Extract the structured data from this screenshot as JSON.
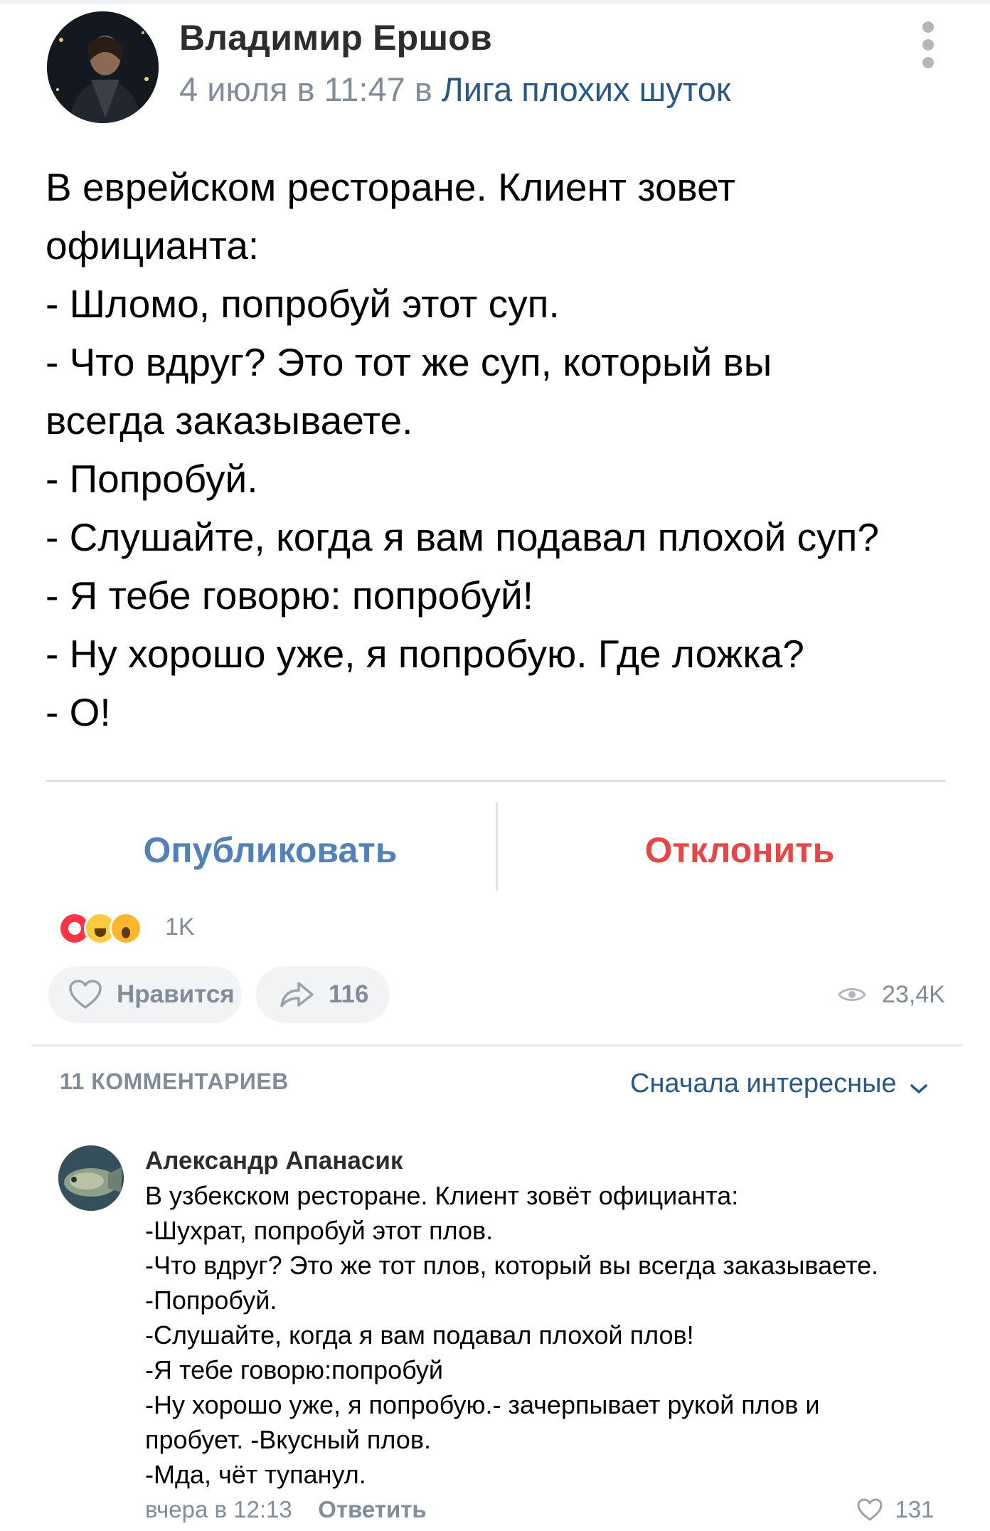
{
  "post": {
    "author": "Владимир Ершов",
    "date": "4 июля в 11:47 в",
    "group": "Лига плохих шуток",
    "text_lines": [
      "В еврейском ресторане. Клиент зовет",
      "официанта:",
      "- Шломо, попробуй этот суп.",
      "- Что вдруг? Это тот же суп, который вы",
      "всегда заказываете.",
      "- Попробуй.",
      "- Слушайте, когда я вам подавал плохой суп?",
      "- Я тебе говорю: попробуй!",
      "- Ну хорошо уже, я попробую. Где ложка?",
      "- О!"
    ]
  },
  "actions": {
    "publish": "Опубликовать",
    "reject": "Отклонить"
  },
  "reactions": {
    "count": "1K"
  },
  "footer": {
    "like_label": "Нравится",
    "share_count": "116",
    "views": "23,4K"
  },
  "comments": {
    "count_label": "11 КОММЕНТАРИЕВ",
    "sort_label": "Сначала интересные",
    "items": [
      {
        "author": "Александр Апанасик",
        "lines": [
          "В узбекском ресторане. Клиент зовёт официанта:",
          "-Шухрат, попробуй этот плов.",
          "-Что вдруг? Это же тот плов, который вы всегда заказываете.",
          "-Попробуй.",
          "-Слушайте, когда я вам подавал плохой плов!",
          "-Я тебе говорю:попробуй",
          "-Ну хорошо уже, я попробую.- зачерпывает рукой плов и",
          "пробует. -Вкусный плов.",
          "-Мда, чёт тупанул."
        ],
        "date": "вчера в 12:13",
        "reply_label": "Ответить",
        "likes": "131"
      }
    ]
  },
  "colors": {
    "link": "#2a5885",
    "accent_blue": "#5181b8",
    "reject_red": "#e64646",
    "secondary_text": "#818c99"
  }
}
